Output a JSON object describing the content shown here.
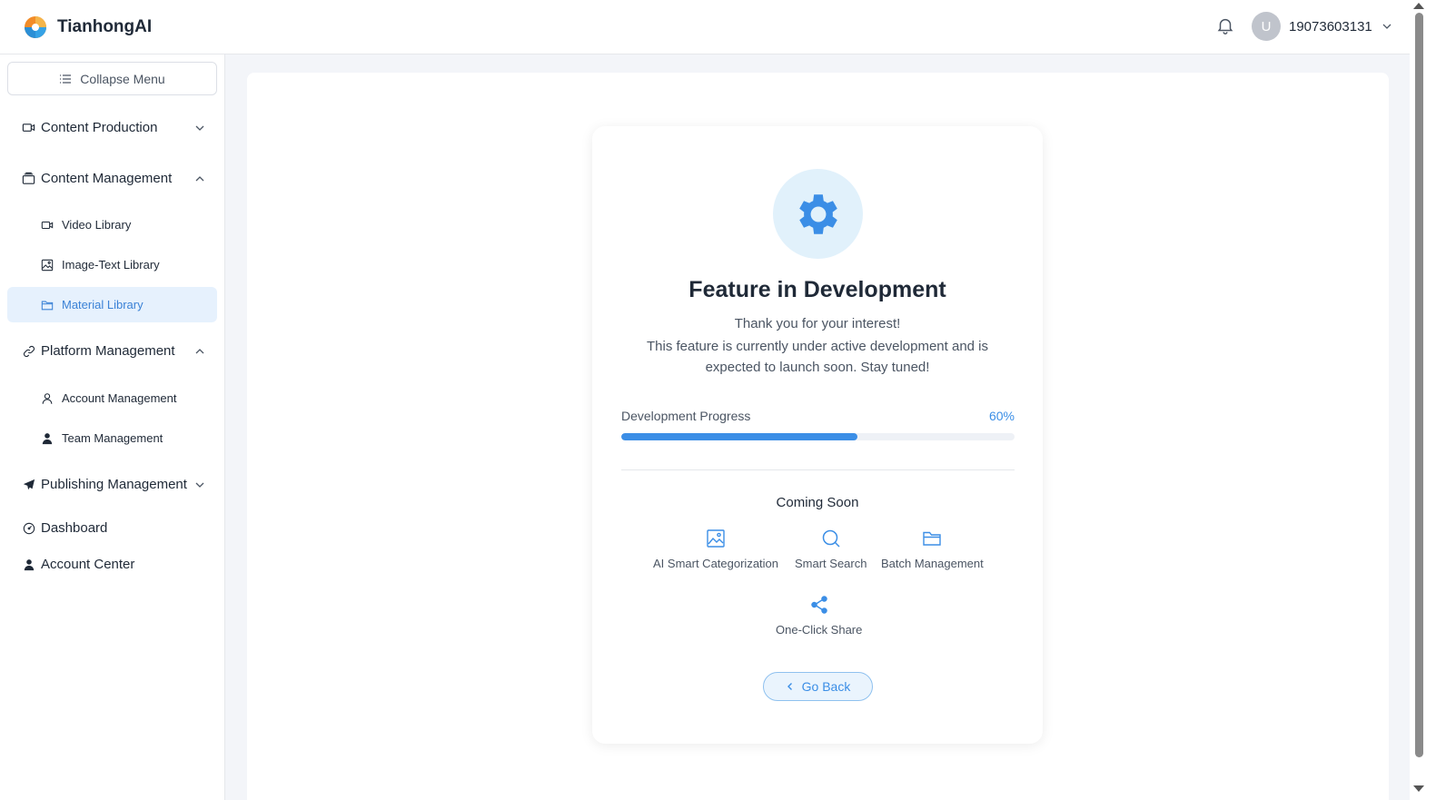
{
  "app": {
    "name": "TianhongAI"
  },
  "header": {
    "user": {
      "avatar_letter": "U",
      "phone": "19073603131"
    }
  },
  "sidebar": {
    "collapse_label": "Collapse Menu",
    "groups": [
      {
        "label": "Content Production",
        "expanded": false
      },
      {
        "label": "Content Management",
        "expanded": true,
        "items": [
          {
            "label": "Video Library"
          },
          {
            "label": "Image-Text Library"
          },
          {
            "label": "Material Library",
            "active": true
          }
        ]
      },
      {
        "label": "Platform Management",
        "expanded": true,
        "items": [
          {
            "label": "Account Management"
          },
          {
            "label": "Team Management"
          }
        ]
      },
      {
        "label": "Publishing Management",
        "expanded": false
      },
      {
        "label": "Dashboard"
      },
      {
        "label": "Account Center"
      }
    ]
  },
  "card": {
    "title": "Feature in Development",
    "subtitle": "Thank you for your interest!",
    "description": "This feature is currently under active development and is expected to launch soon. Stay tuned!",
    "progress": {
      "label": "Development Progress",
      "percent_text": "60%",
      "value": 0.6
    },
    "coming_soon_title": "Coming Soon",
    "features": [
      {
        "label": "AI Smart Categorization",
        "icon": "image-icon"
      },
      {
        "label": "Smart Search",
        "icon": "search-icon"
      },
      {
        "label": "Batch Management",
        "icon": "folder-icon"
      },
      {
        "label": "One-Click Share",
        "icon": "share-icon"
      }
    ],
    "go_back_label": "Go Back"
  },
  "colors": {
    "accent": "#3b8ee6",
    "active_bg": "#e6f1fd",
    "gear_bg": "#e1f1fb"
  }
}
